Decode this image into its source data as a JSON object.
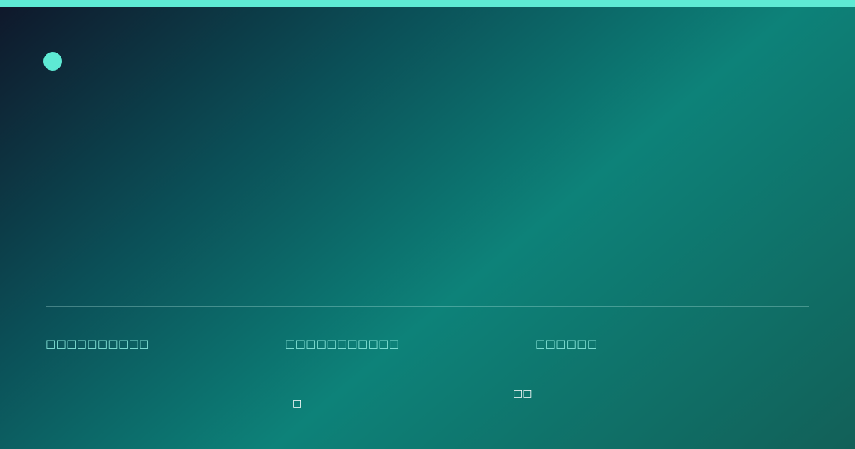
{
  "colors": {
    "accent": "#5eead4",
    "label": "#87e6da",
    "value": "#ffffff"
  },
  "stats": [
    {
      "label": "□□□□□□□□□□"
    },
    {
      "label": "□□□□□□□□□□□"
    },
    {
      "label": "□□□□□□",
      "value": "□□"
    }
  ],
  "footnote_glyph": "□"
}
